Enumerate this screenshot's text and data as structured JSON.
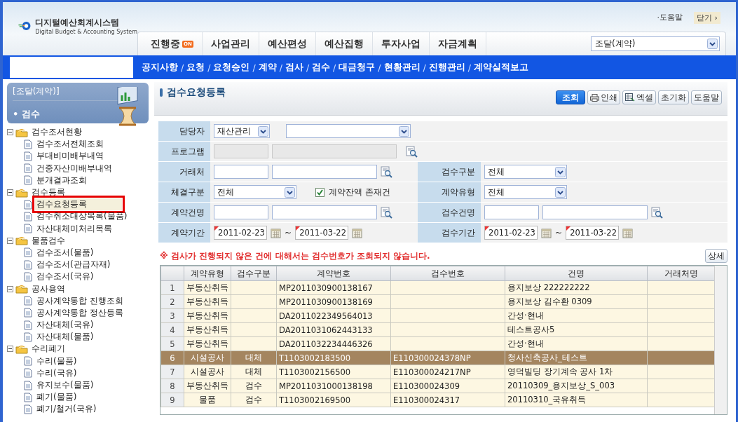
{
  "header": {
    "logo_title": "디지털예산회계시스템",
    "logo_subtitle": "Digital Budget & Accounting System",
    "top_links": [
      {
        "label": "·도움말",
        "kind": "help"
      },
      {
        "label": "닫기 ›",
        "kind": "close"
      }
    ],
    "tabs": [
      {
        "label": "진행중",
        "badge": "ON",
        "selected": false
      },
      {
        "label": "사업관리",
        "selected": false
      },
      {
        "label": "예산편성",
        "selected": false
      },
      {
        "label": "예산집행",
        "selected": false
      },
      {
        "label": "투자사업",
        "selected": false
      },
      {
        "label": "자금계획",
        "selected": false
      }
    ],
    "system_select": {
      "value": "조달(계약)"
    },
    "nav": [
      {
        "label": "공지사항"
      },
      {
        "sep": "/",
        "label": "요청"
      },
      {
        "sep": "/",
        "label": "요청승인"
      },
      {
        "sep": "/",
        "label": "계약"
      },
      {
        "sep": "/",
        "label": "검사"
      },
      {
        "sep": "/",
        "label": "검수"
      },
      {
        "sep": "/",
        "label": "대금청구"
      },
      {
        "sep": "/",
        "label": "현황관리"
      },
      {
        "sep": "/",
        "label": "진행관리"
      },
      {
        "sep": "/",
        "label": "계약실적보고"
      }
    ]
  },
  "sidebar": {
    "section": "[조달(계약)]",
    "current": "• 검수",
    "tree": [
      {
        "label": "검수조서현황",
        "expanded": true,
        "children": [
          {
            "label": "검수조서전체조회",
            "selected": false
          },
          {
            "label": "부대비미배부내역",
            "selected": false
          },
          {
            "label": "건중자산미배부내역",
            "selected": false
          },
          {
            "label": "분개결과조회",
            "selected": false
          }
        ]
      },
      {
        "label": "검수등록",
        "expanded": true,
        "children": [
          {
            "label": "검수요청등록",
            "selected": true
          },
          {
            "label": "검수취소대상목록(물품)",
            "selected": false
          },
          {
            "label": "자산대체미처리목록",
            "selected": false
          }
        ]
      },
      {
        "label": "물품검수",
        "expanded": true,
        "children": [
          {
            "label": "검수조서(물품)",
            "selected": false
          },
          {
            "label": "검수조서(관급자재)",
            "selected": false
          },
          {
            "label": "검수조서(국유)",
            "selected": false
          }
        ]
      },
      {
        "label": "공사용역",
        "expanded": true,
        "children": [
          {
            "label": "공사계약통합 진행조회",
            "selected": false
          },
          {
            "label": "공사계약통합 정산등록",
            "selected": false
          },
          {
            "label": "자산대체(국유)",
            "selected": false
          },
          {
            "label": "자산대체(물품)",
            "selected": false
          }
        ]
      },
      {
        "label": "수리폐기",
        "expanded": true,
        "children": [
          {
            "label": "수리(물품)",
            "selected": false
          },
          {
            "label": "수리(국유)",
            "selected": false
          },
          {
            "label": "유지보수(물품)",
            "selected": false
          },
          {
            "label": "폐기(물품)",
            "selected": false
          },
          {
            "label": "폐기/철거(국유)",
            "selected": false
          }
        ]
      }
    ]
  },
  "page": {
    "title": "검수요청등록",
    "buttons": [
      {
        "label": "조회",
        "kind": "primary"
      },
      {
        "label": "인쇄",
        "kind": "print"
      },
      {
        "label": "엑셀",
        "kind": "excel"
      },
      {
        "label": "초기화",
        "kind": "plain"
      },
      {
        "label": "도움말",
        "kind": "plain"
      }
    ],
    "form": [
      {
        "left": [
          {
            "kind": "label",
            "text": "담당자"
          },
          {
            "kind": "select_small",
            "value": "재산관리"
          },
          {
            "kind": "select_full"
          }
        ]
      },
      {
        "left": [
          {
            "kind": "label",
            "text": "프로그램"
          },
          {
            "kind": "input",
            "disabled": true
          },
          {
            "kind": "input_full",
            "disabled": true
          },
          {
            "kind": "search"
          }
        ]
      },
      {
        "left": [
          {
            "kind": "label",
            "text": "거래처"
          },
          {
            "kind": "input",
            "disabled": false
          },
          {
            "kind": "input_wide",
            "disabled": false
          },
          {
            "kind": "search"
          }
        ],
        "right": [
          {
            "kind": "label",
            "text": "검수구분"
          },
          {
            "kind": "select",
            "value": "전체"
          }
        ]
      },
      {
        "left": [
          {
            "kind": "label",
            "text": "체결구분"
          },
          {
            "kind": "select",
            "value": "전체"
          },
          {
            "kind": "checkbox",
            "text": "계약잔액 존재건",
            "checked": true
          }
        ],
        "right": [
          {
            "kind": "label",
            "text": "계약유형"
          },
          {
            "kind": "select",
            "value": "전체"
          }
        ]
      },
      {
        "left": [
          {
            "kind": "label",
            "text": "계약건명"
          },
          {
            "kind": "input",
            "disabled": false
          },
          {
            "kind": "input_wide",
            "disabled": false
          },
          {
            "kind": "search"
          }
        ],
        "right": [
          {
            "kind": "label",
            "text": "검수건명"
          },
          {
            "kind": "input",
            "disabled": false
          },
          {
            "kind": "input_wide",
            "disabled": false
          },
          {
            "kind": "search"
          }
        ]
      },
      {
        "left": [
          {
            "kind": "label",
            "text": "계약기간"
          },
          {
            "kind": "date",
            "value": "2011-02-23"
          },
          {
            "kind": "calendar"
          },
          {
            "kind": "tilde",
            "text": "~"
          },
          {
            "kind": "date",
            "value": "2011-03-22"
          },
          {
            "kind": "calendar"
          }
        ],
        "right": [
          {
            "kind": "label",
            "text": "검수기간"
          },
          {
            "kind": "date",
            "value": "2011-02-23"
          },
          {
            "kind": "calendar"
          },
          {
            "kind": "tilde",
            "text": "~"
          },
          {
            "kind": "date",
            "value": "2011-03-22"
          },
          {
            "kind": "calendar"
          }
        ]
      }
    ],
    "notice": "※ 검사가 진행되지 않은 건에 대해서는 검수번호가 조회되지 않습니다.",
    "detail_button": "상세",
    "table": {
      "columns": [
        "계약유형",
        "검수구분",
        "계약번호",
        "검수번호",
        "건명",
        "거래처명"
      ],
      "rows": [
        {
          "no": "1",
          "cells": [
            "부동산취득",
            null,
            "MP2011030900138167",
            null,
            "용지보상 222222222"
          ],
          "selected": false
        },
        {
          "no": "2",
          "cells": [
            "부동산취득",
            null,
            "MP2011030900138169",
            null,
            "용지보상 김수환 0309"
          ],
          "selected": false
        },
        {
          "no": "3",
          "cells": [
            "부동산취득",
            null,
            "DA2011022349564013",
            null,
            "간성·현내"
          ],
          "selected": false
        },
        {
          "no": "4",
          "cells": [
            "부동산취득",
            null,
            "DA2011031062443133",
            null,
            "테스트공사5"
          ],
          "selected": false
        },
        {
          "no": "5",
          "cells": [
            "부동산취득",
            null,
            "DA2011032234446326",
            null,
            "간성·현내"
          ],
          "selected": false
        },
        {
          "no": "6",
          "cells": [
            "시설공사",
            "대체",
            "T1103002183500",
            "E110300024378NP",
            "청사신축공사_테스트"
          ],
          "selected": true
        },
        {
          "no": "7",
          "cells": [
            "시설공사",
            "대체",
            "T1103002156500",
            "E110300024217NP",
            "영덕빌딩 장기계속 공사 1차"
          ],
          "selected": false
        },
        {
          "no": "8",
          "cells": [
            "부동산취득",
            "검수",
            "MP2011031000138198",
            "E110300024309",
            "20110309_용지보상_S_003"
          ],
          "selected": false
        },
        {
          "no": "9",
          "cells": [
            "물품",
            "검수",
            "T1103002169500",
            "E110300024317",
            "20110310_국유취득"
          ],
          "selected": false
        }
      ]
    }
  }
}
